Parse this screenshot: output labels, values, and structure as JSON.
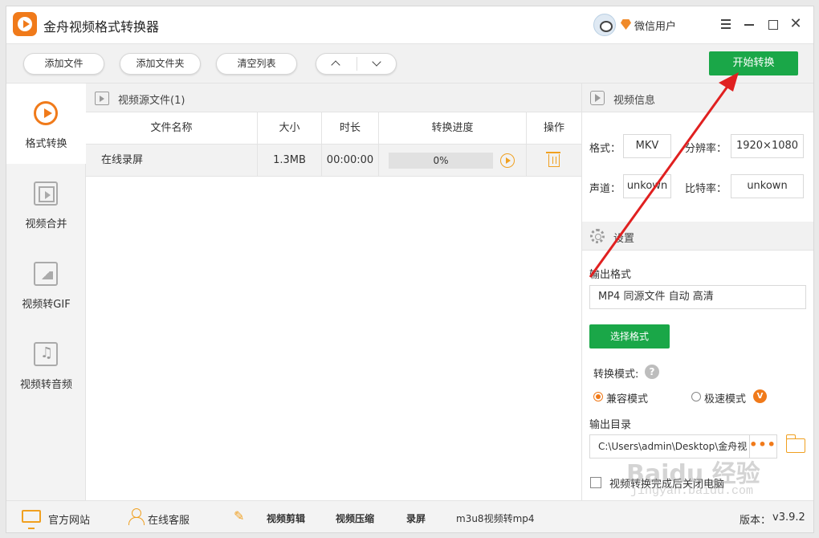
{
  "app": {
    "title": "金舟视频格式转换器",
    "user_name": "微信用户"
  },
  "toolbar": {
    "add_file": "添加文件",
    "add_folder": "添加文件夹",
    "clear_list": "清空列表",
    "start_convert": "开始转换"
  },
  "sidebar": {
    "items": [
      {
        "label": "格式转换",
        "icon": "convert-icon",
        "active": true
      },
      {
        "label": "视频合并",
        "icon": "merge-icon",
        "active": false
      },
      {
        "label": "视频转GIF",
        "icon": "gif-icon",
        "active": false
      },
      {
        "label": "视频转音频",
        "icon": "audio-icon",
        "active": false
      }
    ]
  },
  "file_list": {
    "title": "视频源文件(1)",
    "columns": [
      "文件名称",
      "大小",
      "时长",
      "转换进度",
      "操作"
    ],
    "rows": [
      {
        "name": "在线录屏",
        "size": "1.3MB",
        "duration": "00:00:00",
        "progress": 0,
        "progress_text": "0%"
      }
    ]
  },
  "video_info": {
    "title": "视频信息",
    "format_label": "格式：",
    "format_value": "MKV",
    "resolution_label": "分辨率：",
    "resolution_value": "1920×1080",
    "channel_label": "声道：",
    "channel_value": "unkown",
    "bitrate_label": "比特率：",
    "bitrate_value": "unkown"
  },
  "settings": {
    "title": "设置",
    "output_format_label": "输出格式",
    "output_format_value": "MP4 同源文件 自动 高清",
    "select_format_button": "选择格式",
    "mode_label": "转换模式:",
    "mode_compat": "兼容模式",
    "mode_fast": "极速模式",
    "output_dir_label": "输出目录",
    "output_dir_value": "C:\\Users\\admin\\Desktop\\金舟视",
    "shutdown_label": "视频转换完成后关闭电脑"
  },
  "bottom": {
    "website": "官方网站",
    "support": "在线客服",
    "edit": "视频剪辑",
    "compress": "视频压缩",
    "record": "录屏",
    "m3u8": "m3u8视频转mp4",
    "version_label": "版本：",
    "version_value": "v3.9.2"
  },
  "watermark": {
    "main": "Baidu 经验",
    "sub": "jingyan.baidu.com"
  },
  "colors": {
    "accent": "#1aa748",
    "brand": "#f07a1a",
    "annotation_arrow": "#e02020"
  }
}
